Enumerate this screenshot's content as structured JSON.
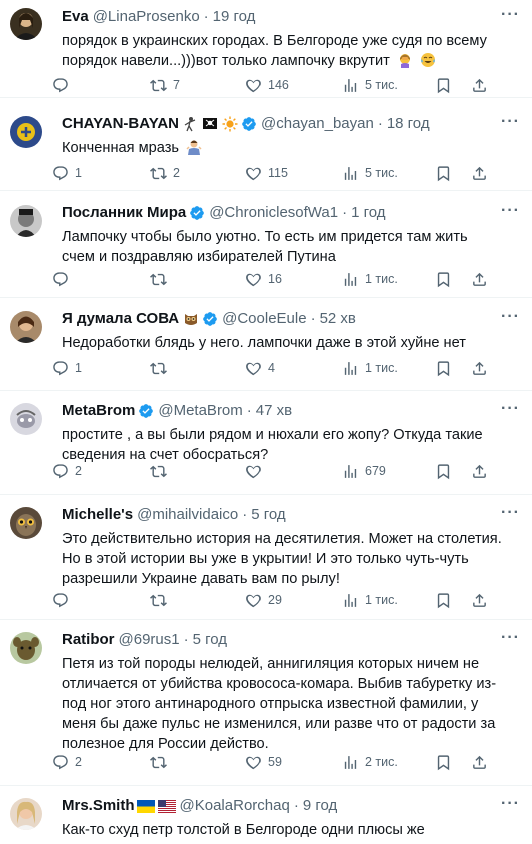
{
  "tweets": [
    {
      "name": "Eva",
      "handle": "@LinaProsenko",
      "time": "19 год",
      "text": "порядок в украинских городах. В Белгороде уже судя по всему порядок навели...)))вот только лампочку вкрутит",
      "replies": "",
      "retweets": "7",
      "likes": "146",
      "views": "5 тис."
    },
    {
      "name": "CHAYAN-BAYAN",
      "handle": "@chayan_bayan",
      "time": "18 год",
      "text": "Конченная мразь",
      "replies": "1",
      "retweets": "2",
      "likes": "115",
      "views": "5 тис."
    },
    {
      "name": "Посланник Мира",
      "handle": "@ChroniclesofWa1",
      "time": "1 год",
      "text": "Лампочку чтобы было уютно. То есть им придется там жить счем и поздравляю избирателей Путина",
      "replies": "",
      "retweets": "",
      "likes": "16",
      "views": "1 тис."
    },
    {
      "name": "Я думала СОВА",
      "handle": "@CooleEule",
      "time": "52 хв",
      "text": "Недоработки блядь у него. лампочки даже в этой хуйне нет",
      "replies": "1",
      "retweets": "",
      "likes": "4",
      "views": "1 тис."
    },
    {
      "name": "MetaBrom",
      "handle": "@MetaBrom",
      "time": "47 хв",
      "text": "простите , а вы были рядом и нюхали его жопу? Откуда такие сведения на счет обосраться?",
      "replies": "2",
      "retweets": "",
      "likes": "",
      "views": "679"
    },
    {
      "name": "Michelle's",
      "handle": "@mihailvidaico",
      "time": "5 год",
      "text": "Это действительно история на десятилетия. Может на столетия. Но в этой истории вы уже в укрытии! И это только чуть-чуть разрешили Украине давать вам по рылу!",
      "replies": "",
      "retweets": "",
      "likes": "29",
      "views": "1 тис."
    },
    {
      "name": "Ratibor",
      "handle": "@69rus1",
      "time": "5 год",
      "text": "Петя из той породы нелюдей, аннигиляция которых ничем не отличается от убийства кровососа-комара. Выбив табуретку из-под ног этого антинародного отпрыска известной фамилии, у меня бы даже пульс не изменился, или разве что от радости за полезное для России действо.",
      "replies": "2",
      "retweets": "",
      "likes": "59",
      "views": "2 тис."
    },
    {
      "name": "Mrs.Smith",
      "handle": "@KoalaRorchaq",
      "time": "9 год",
      "text": "Как-то схуд петр толстой в Белгороде одни плюсы же"
    }
  ],
  "dot": "·",
  "more": "···",
  "colors": {
    "verified": "#1d9bf0",
    "muted": "#536471",
    "text": "#0f1419",
    "divider": "#eff3f4"
  }
}
